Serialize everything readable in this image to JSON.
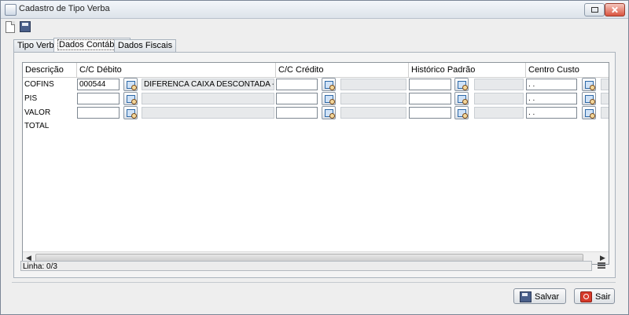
{
  "window": {
    "title": "Cadastro de Tipo Verba"
  },
  "tabs": [
    {
      "label": "Tipo Verba"
    },
    {
      "label": "Dados Contábeis"
    },
    {
      "label": "Dados Fiscais"
    }
  ],
  "grid": {
    "columns": [
      "Descrição",
      "C/C Débito",
      "C/C Crédito",
      "Histórico Padrão",
      "Centro Custo"
    ],
    "rows": [
      {
        "descricao": "COFINS",
        "cc_debito": "000544",
        "cc_debito_desc": "DIFERENCA CAIXA DESCONTADA - DEB",
        "cc_credito": "",
        "historico": "",
        "centro_custo": " .  ."
      },
      {
        "descricao": "PIS",
        "cc_debito": "",
        "cc_debito_desc": "",
        "cc_credito": "",
        "historico": "",
        "centro_custo": " .  ."
      },
      {
        "descricao": "VALOR TOTAL",
        "cc_debito": "",
        "cc_debito_desc": "",
        "cc_credito": "",
        "historico": "",
        "centro_custo": " .  ."
      }
    ]
  },
  "status": {
    "linha": "Linha: 0/3"
  },
  "buttons": {
    "save": "Salvar",
    "exit": "Sair"
  },
  "icons": {
    "new": "new-document-icon",
    "save": "save-icon",
    "lookup": "lookup-icon",
    "exit": "exit-icon"
  },
  "colors": {
    "title_bar": "#dde3ea",
    "grid_bg": "#ffffff",
    "readonly": "#e7e9eb"
  }
}
